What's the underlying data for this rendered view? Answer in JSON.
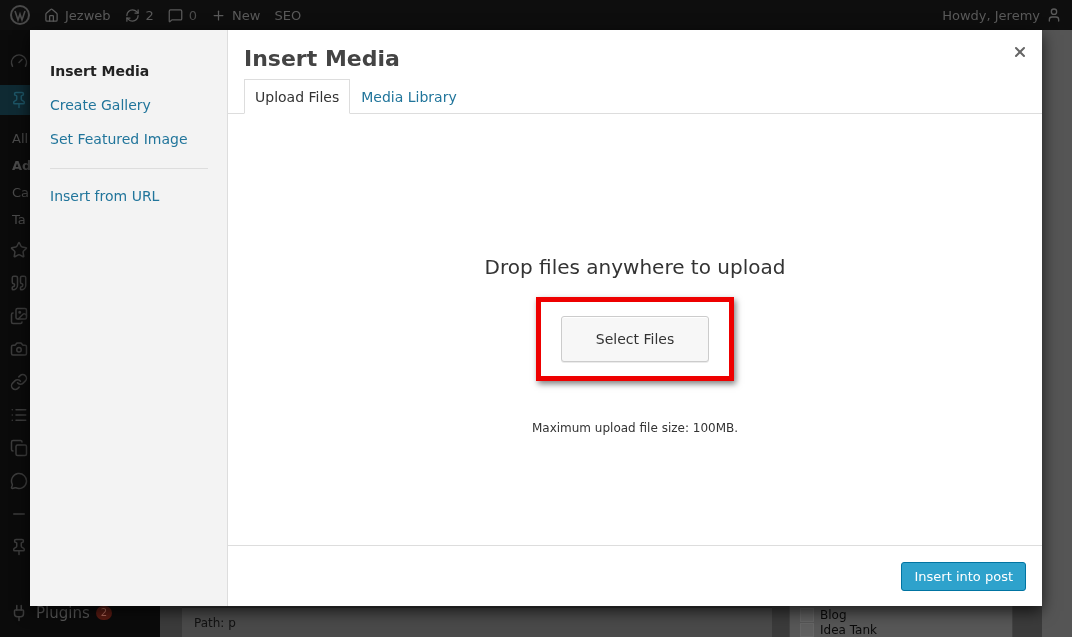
{
  "admin_bar": {
    "site": "Jezweb",
    "updates": "2",
    "comments": "0",
    "new": "New",
    "seo": "SEO",
    "greeting": "Howdy, Jeremy"
  },
  "admin_menu": {
    "items": [
      {
        "kind": "icon",
        "selected": false
      },
      {
        "kind": "icon",
        "selected": true
      },
      {
        "kind": "sub",
        "label": "All",
        "selected": false
      },
      {
        "kind": "sub",
        "label": "Ad",
        "selected": true
      },
      {
        "kind": "sub",
        "label": "Ca",
        "selected": false
      },
      {
        "kind": "sub",
        "label": "Ta",
        "selected": false
      },
      {
        "kind": "icon",
        "selected": false
      },
      {
        "kind": "icon",
        "selected": false
      },
      {
        "kind": "icon",
        "selected": false
      },
      {
        "kind": "icon",
        "selected": false
      },
      {
        "kind": "icon",
        "selected": false
      },
      {
        "kind": "icon",
        "selected": false
      },
      {
        "kind": "icon",
        "selected": false
      },
      {
        "kind": "icon",
        "selected": false
      },
      {
        "kind": "icon",
        "selected": false
      },
      {
        "kind": "icon",
        "selected": false
      },
      {
        "kind": "labeled",
        "label": "Plugins",
        "badge": "2",
        "selected": false
      }
    ]
  },
  "editor": {
    "path": "Path: p"
  },
  "categories": [
    {
      "label": "Blog",
      "checked": false
    },
    {
      "label": "Idea Tank",
      "checked": false
    }
  ],
  "modal": {
    "title": "Insert Media",
    "menu": [
      {
        "label": "Insert Media",
        "selected": true,
        "separator_after": false
      },
      {
        "label": "Create Gallery",
        "selected": false,
        "separator_after": false
      },
      {
        "label": "Set Featured Image",
        "selected": false,
        "separator_after": true
      },
      {
        "label": "Insert from URL",
        "selected": false,
        "separator_after": false
      }
    ],
    "tabs": [
      {
        "label": "Upload Files",
        "selected": true
      },
      {
        "label": "Media Library",
        "selected": false
      }
    ],
    "upload": {
      "heading": "Drop files anywhere to upload",
      "button": "Select Files",
      "highlighted": true,
      "note": "Maximum upload file size: 100MB."
    },
    "footer_button": "Insert into post"
  }
}
